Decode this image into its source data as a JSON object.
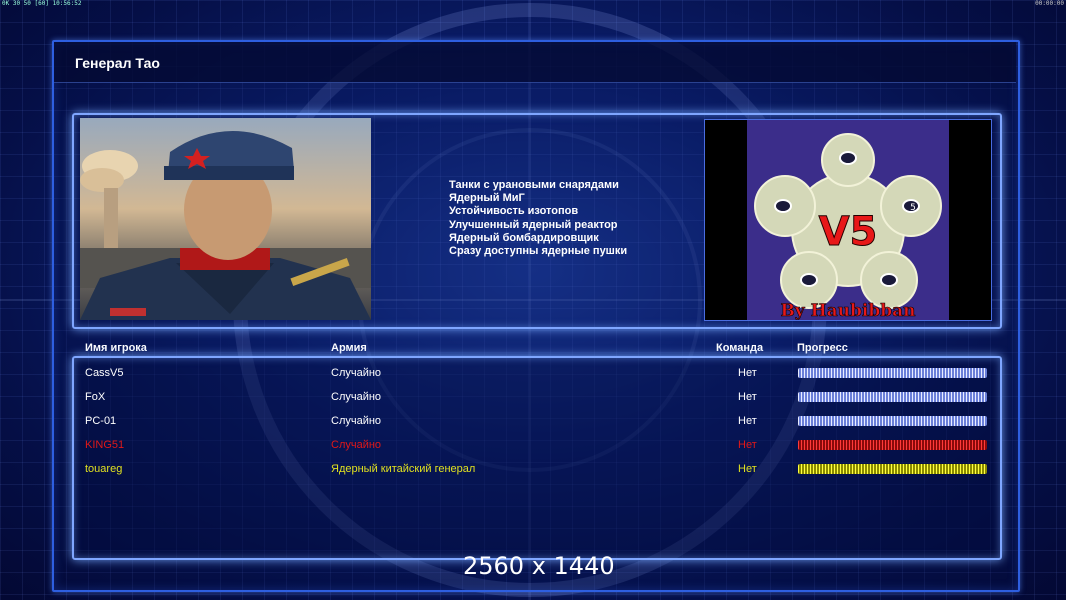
{
  "topbar": {
    "left_status": "0K 30 50 [60] 10:56:52",
    "right_clock": "00:00:00"
  },
  "title": "Генерал Тао",
  "abilities": [
    "Танки с урановыми снарядами",
    "Ядерный МиГ",
    "Устойчивость изотопов",
    "Улучшенный ядерный реактор",
    "Ядерный бомбардировщик",
    "Сразу доступны ядерные пушки"
  ],
  "map": {
    "title": "V5",
    "caption": "By Haubibban",
    "start_marker": "5"
  },
  "table": {
    "headers": {
      "player": "Имя игрока",
      "army": "Армия",
      "team": "Команда",
      "progress": "Прогресс"
    },
    "rows": [
      {
        "name": "CassV5",
        "army": "Случайно",
        "team": "Нет",
        "color": "#ffffff",
        "bar": "white"
      },
      {
        "name": "FoX",
        "army": "Случайно",
        "team": "Нет",
        "color": "#ffffff",
        "bar": "white"
      },
      {
        "name": "PC-01",
        "army": "Случайно",
        "team": "Нет",
        "color": "#ffffff",
        "bar": "white"
      },
      {
        "name": "KING51",
        "army": "Случайно",
        "team": "Нет",
        "color": "#e01818",
        "bar": "red"
      },
      {
        "name": "touareg",
        "army": "Ядерный китайский генерал",
        "team": "Нет",
        "color": "#e0e020",
        "bar": "yellow"
      }
    ]
  },
  "watermark": "2560 x 1440",
  "colors": {
    "accent": "#7fa6ff",
    "background": "#0b1f6e"
  }
}
